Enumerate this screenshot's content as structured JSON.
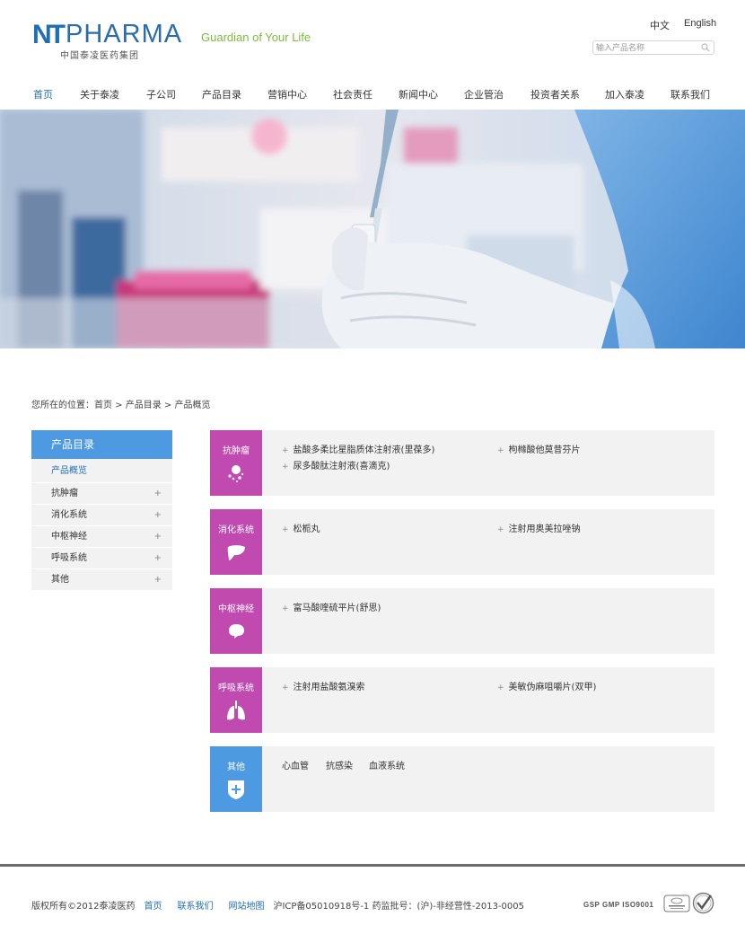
{
  "header": {
    "logo_nt": "NT",
    "logo_pharma": "PHARMA",
    "logo_cn": "中国泰凌医药集团",
    "slogan": "Guardian of Your Life",
    "lang_cn": "中文",
    "lang_en": "English",
    "search_placeholder": "输入产品名称"
  },
  "nav": {
    "items": [
      "首页",
      "关于泰凌",
      "子公司",
      "产品目录",
      "营销中心",
      "社会责任",
      "新闻中心",
      "企业管治",
      "投资者关系",
      "加入泰凌",
      "联系我们"
    ]
  },
  "breadcrumb": "您所在的位置：首页 > 产品目录 > 产品概览",
  "sidebar": {
    "title": "产品目录",
    "items": [
      "产品概览",
      "抗肿瘤",
      "消化系统",
      "中枢神经",
      "呼吸系统",
      "其他"
    ],
    "plus": "+"
  },
  "categories": [
    {
      "label": "抗肿瘤",
      "icon": "cells-icon",
      "links": [
        "盐酸多柔比星脂质体注射液(里葆多)",
        "尿多酸肽注射液(喜滴克)",
        "枸橼酸他莫昔芬片"
      ]
    },
    {
      "label": "消化系统",
      "icon": "liver-icon",
      "links": [
        "松栀丸",
        "注射用奥美拉唑钠"
      ]
    },
    {
      "label": "中枢神经",
      "icon": "brain-icon",
      "links": [
        "富马酸喹硫平片(舒思)"
      ]
    },
    {
      "label": "呼吸系统",
      "icon": "lungs-icon",
      "links": [
        "注射用盐酸氨溴索",
        "美敏伪麻咀嚼片(双甲)"
      ]
    },
    {
      "label": "其他",
      "icon": "plus-shield-icon",
      "links": [
        "心血管",
        "抗感染",
        "血液系统"
      ]
    }
  ],
  "bullet": "+",
  "footer": {
    "copyright": "版权所有©2012泰凌医药",
    "home": "首页",
    "contact": "联系我们",
    "sitemap": "网站地图",
    "icp": "沪ICP备05010918号-1 药监批号：(沪)-非经营性-2013-0005",
    "cert": "GSP GMP ISO9001"
  },
  "colors": {
    "brand_blue": "#1f6fb5",
    "accent_magenta": "#c14ab0",
    "sidebar_blue": "#4d9ae3",
    "slogan_green": "#7dbb3c"
  }
}
